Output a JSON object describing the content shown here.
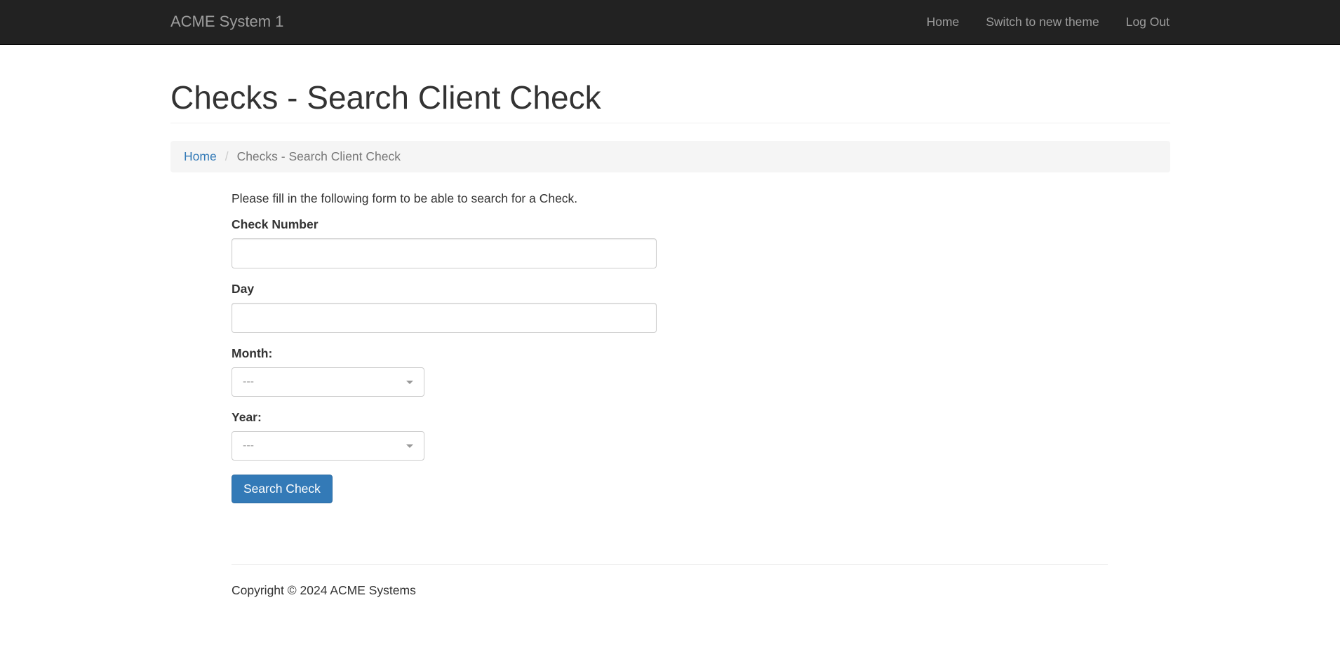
{
  "navbar": {
    "brand": "ACME System 1",
    "links": [
      "Home",
      "Switch to new theme",
      "Log Out"
    ]
  },
  "page": {
    "title": "Checks - Search Client Check"
  },
  "breadcrumb": {
    "home": "Home",
    "separator": "/",
    "current": "Checks - Search Client Check"
  },
  "form": {
    "intro": "Please fill in the following form to be able to search for a Check.",
    "check_number_label": "Check Number",
    "check_number_value": "",
    "day_label": "Day",
    "day_value": "",
    "month_label": "Month:",
    "month_selected": "---",
    "year_label": "Year:",
    "year_selected": "---",
    "submit_label": "Search Check"
  },
  "footer": {
    "copyright": "Copyright © 2024 ACME Systems"
  },
  "colors": {
    "navbar_bg": "#222222",
    "nav_text": "#9d9d9d",
    "link": "#337ab7",
    "primary_button": "#337ab7",
    "breadcrumb_bg": "#f5f5f5"
  }
}
